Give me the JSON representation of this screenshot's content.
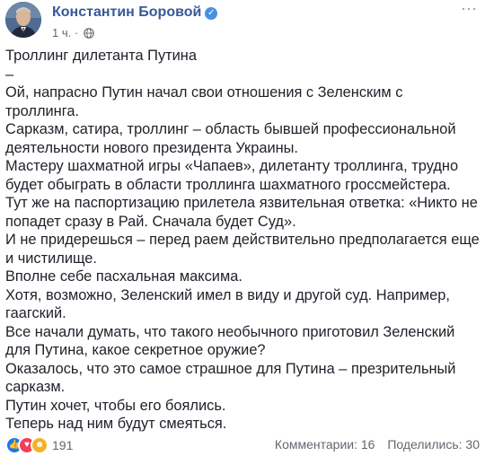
{
  "post": {
    "author": "Константин Боровой",
    "timestamp": "1 ч.",
    "privacy_icon": "globe-icon",
    "paragraphs": [
      "Троллинг дилетанта Путина",
      "–",
      "Ой, напрасно Путин начал свои отношения с Зеленским с троллинга.",
      "Сарказм, сатира, троллинг – область бывшей профессиональной деятельности нового президента Украины.",
      "Мастеру шахматной игры «Чапаев», дилетанту троллинга, трудно будет обыграть в области троллинга шахматного гроссмейстера.",
      "Тут же на паспортизацию прилетела язвительная ответка: «Никто не попадет сразу в Рай. Сначала будет Суд».",
      "И не придерешься – перед раем действительно предполагается еще и чистилище.",
      "Вполне себе пасхальная максима.",
      "Хотя, возможно, Зеленский имел в виду и другой суд. Например, гаагский.",
      "Все начали думать, что такого необычного приготовил Зеленский для Путина, какое секретное оружие?",
      "Оказалось, что это самое страшное для Путина – презрительный сарказм.",
      "Путин хочет, чтобы его боялись.",
      "Теперь над ним будут смеяться."
    ]
  },
  "footer": {
    "reactions": [
      "like-icon",
      "love-icon",
      "haha-icon"
    ],
    "reaction_count": "191",
    "comments": "Комментарии: 16",
    "shares": "Поделились: 30"
  },
  "colors": {
    "author_link": "#385898",
    "meta_gray": "#616770",
    "text": "#1d2129",
    "like_blue": "#1877f2",
    "love_red": "#f33e58",
    "haha_yellow": "#f7b125"
  }
}
